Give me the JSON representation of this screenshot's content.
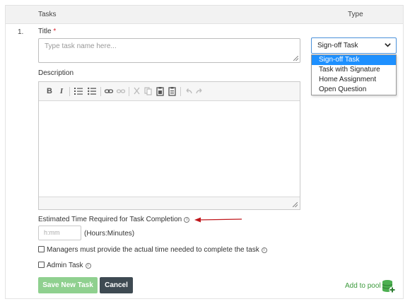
{
  "header": {
    "tasks_col": "Tasks",
    "type_col": "Type"
  },
  "task": {
    "number": "1.",
    "title_label": "Title",
    "required_mark": "*",
    "title_placeholder": "Type task name here...",
    "description_label": "Description"
  },
  "type_select": {
    "value": "Sign-off Task",
    "options": [
      "Sign-off Task",
      "Task with Signature",
      "Home Assignment",
      "Open Question"
    ],
    "selected_index": 0
  },
  "editor": {
    "toolbar": [
      "bold",
      "italic",
      "numbered-list",
      "bulleted-list",
      "link",
      "unlink",
      "cut",
      "copy",
      "paste",
      "paste-text",
      "undo",
      "redo"
    ],
    "bold_glyph": "B",
    "italic_glyph": "I"
  },
  "time": {
    "label": "Estimated Time Required for Task Completion",
    "placeholder": "h:mm",
    "unit_hint": "(Hours:Minutes)"
  },
  "checkboxes": {
    "managers_label": "Managers must provide the actual time needed to complete the task",
    "managers_checked": false,
    "admin_label": "Admin Task",
    "admin_checked": false
  },
  "buttons": {
    "save": "Save New Task",
    "cancel": "Cancel"
  },
  "add_to_pool": "Add to pool",
  "colors": {
    "accent": "#1e90ff",
    "save_bg": "#8fd08f",
    "cancel_bg": "#3e4a52",
    "pool_green": "#3c9a3c",
    "arrow_red": "#c0171c"
  }
}
